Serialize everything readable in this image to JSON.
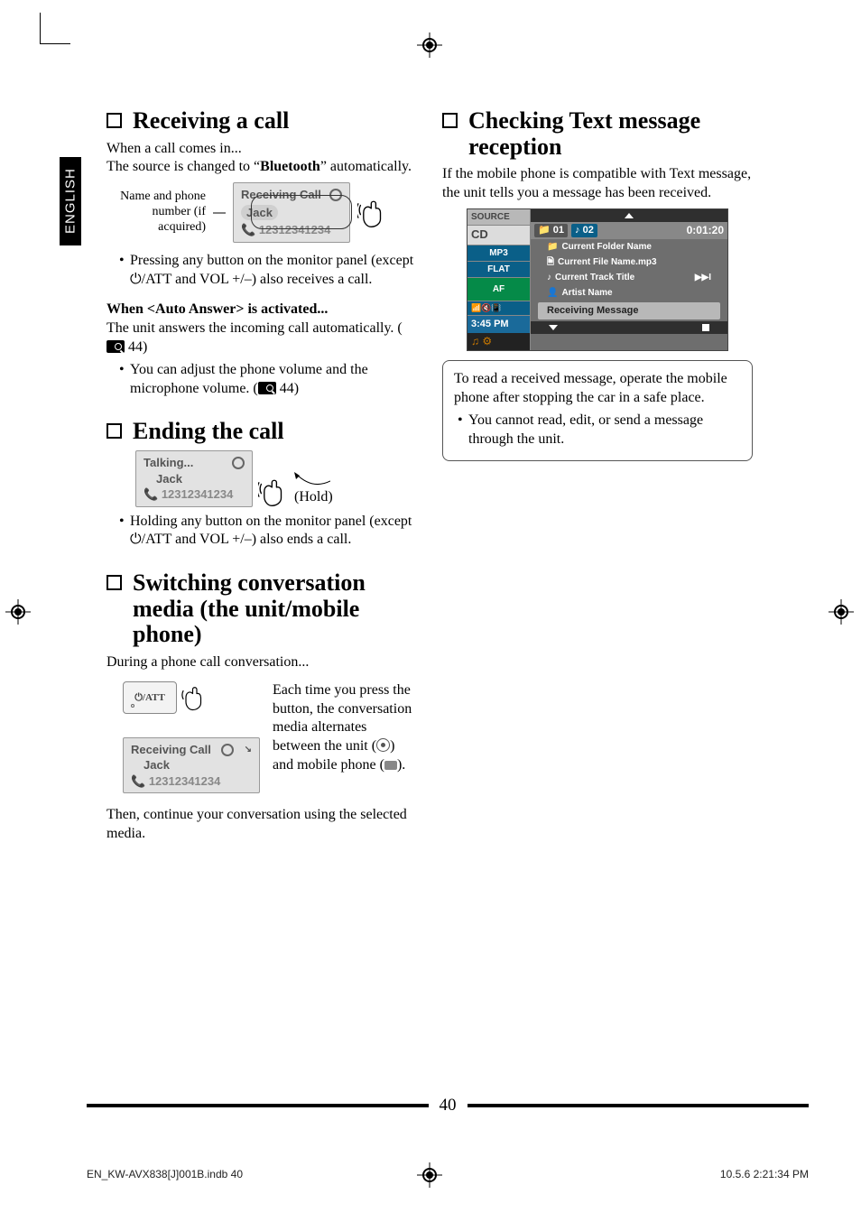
{
  "page_number": "40",
  "language_tab": "ENGLISH",
  "footer": {
    "left": "EN_KW-AVX838[J]001B.indb   40",
    "right": "10.5.6   2:21:34 PM"
  },
  "left": {
    "receiving": {
      "heading": "Receiving a call",
      "line1": "When a call comes in...",
      "line2a": "The source is changed to “",
      "line2b": "Bluetooth",
      "line2c": "” automatically.",
      "label1": "Name and phone",
      "label2": "number (if acquired)",
      "screen": {
        "title": "Receiving Call",
        "name": "Jack",
        "number": "12312341234"
      },
      "bullet1a": "Pressing any button on the monitor panel (except ",
      "bullet1b": "/ATT and VOL +/–) also receives a call.",
      "auto_heading": "When <Auto Answer> is activated...",
      "auto_line": "The unit answers the incoming call automatically. (",
      "auto_ref": " 44)",
      "auto_bullet": "You can adjust the phone volume and the microphone volume. (",
      "auto_bullet_ref": " 44)"
    },
    "ending": {
      "heading": "Ending the call",
      "screen": {
        "title": "Talking...",
        "name": "Jack",
        "number": "12312341234"
      },
      "hold": "(Hold)",
      "bullet_a": "Holding any button on the monitor panel (except ",
      "bullet_b": "/ATT and VOL +/–) also ends a call."
    },
    "switching": {
      "heading": "Switching conversation media (the unit/mobile phone)",
      "intro": "During a phone call conversation...",
      "btn_label": "⏻/ATT",
      "screen": {
        "title": "Receiving Call",
        "name": "Jack",
        "number": "12312341234"
      },
      "desc1": "Each time you press the button, the conversation media alternates between the unit (",
      "desc2": ") and mobile phone (",
      "desc3": ").",
      "then": "Then, continue your conversation using the selected media."
    }
  },
  "right": {
    "checking": {
      "heading": "Checking Text message reception",
      "intro": "If the mobile phone is compatible with Text message, the unit tells you a message has been received.",
      "big_screen": {
        "left_rows": {
          "source": "SOURCE",
          "cd": "CD",
          "mp3": "MP3",
          "flat": "FLAT",
          "af": "AF",
          "icons": "",
          "time": "3:45 PM"
        },
        "tabs": {
          "folder": "01",
          "track": "02",
          "time": "0:01:20"
        },
        "lines": {
          "folder": "Current Folder Name",
          "file": "Current File Name.mp3",
          "track": "Current Track Title",
          "artist": "Artist Name"
        },
        "receiving": "Receiving Message"
      },
      "box_line1": "To read a received message, operate the mobile phone after stopping the car in a safe place.",
      "box_bullet": "You cannot read, edit, or send a message through the unit."
    }
  }
}
